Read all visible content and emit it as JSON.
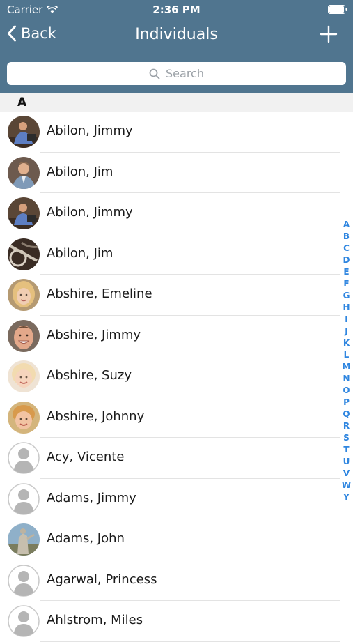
{
  "status_bar": {
    "carrier": "Carrier",
    "time": "2:36 PM"
  },
  "nav": {
    "back_label": "Back",
    "title": "Individuals",
    "add_icon": "plus-icon"
  },
  "search": {
    "placeholder": "Search",
    "icon": "search-icon"
  },
  "section": {
    "letter": "A"
  },
  "contacts": [
    {
      "name": "Abilon, Jimmy",
      "avatar": "photo-man-podium"
    },
    {
      "name": "Abilon, Jim",
      "avatar": "photo-man-suit"
    },
    {
      "name": "Abilon, Jimmy",
      "avatar": "photo-man-podium"
    },
    {
      "name": "Abilon, Jim",
      "avatar": "photo-bicycle"
    },
    {
      "name": "Abshire, Emeline",
      "avatar": "photo-woman-blonde"
    },
    {
      "name": "Abshire, Jimmy",
      "avatar": "photo-man-smiling"
    },
    {
      "name": "Abshire, Suzy",
      "avatar": "photo-girl"
    },
    {
      "name": "Abshire, Johnny",
      "avatar": "photo-boy"
    },
    {
      "name": "Acy, Vicente",
      "avatar": "placeholder"
    },
    {
      "name": "Adams, Jimmy",
      "avatar": "placeholder"
    },
    {
      "name": "Adams, John",
      "avatar": "photo-statue"
    },
    {
      "name": "Agarwal, Princess",
      "avatar": "placeholder"
    },
    {
      "name": "Ahlstrom, Miles",
      "avatar": "placeholder"
    }
  ],
  "index_letters": [
    "A",
    "B",
    "C",
    "D",
    "E",
    "F",
    "G",
    "H",
    "I",
    "J",
    "K",
    "L",
    "M",
    "N",
    "O",
    "P",
    "Q",
    "R",
    "S",
    "T",
    "U",
    "V",
    "W",
    "Y"
  ],
  "colors": {
    "header": "#50758f",
    "index": "#2f86e0",
    "section_bg": "#f1f1f1"
  }
}
